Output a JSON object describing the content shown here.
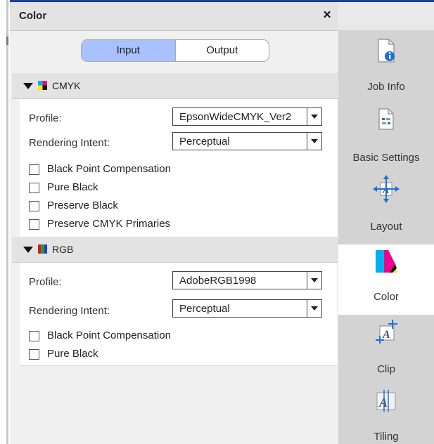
{
  "panel": {
    "title": "Color",
    "close_symbol": "×"
  },
  "mode_tabs": {
    "input": "Input",
    "output": "Output",
    "selected": "Input"
  },
  "cmyk": {
    "title": "CMYK",
    "profile_label": "Profile:",
    "profile_value": "EpsonWideCMYK_Ver2",
    "intent_label": "Rendering Intent:",
    "intent_value": "Perceptual",
    "checkboxes": [
      {
        "label": "Black Point Compensation",
        "checked": false
      },
      {
        "label": "Pure Black",
        "checked": false
      },
      {
        "label": "Preserve Black",
        "checked": false
      },
      {
        "label": "Preserve CMYK Primaries",
        "checked": false
      }
    ]
  },
  "rgb": {
    "title": "RGB",
    "profile_label": "Profile:",
    "profile_value": "AdobeRGB1998",
    "intent_label": "Rendering Intent:",
    "intent_value": "Perceptual",
    "checkboxes": [
      {
        "label": "Black Point Compensation",
        "checked": false
      },
      {
        "label": "Pure Black",
        "checked": false
      }
    ]
  },
  "side_tabs": [
    {
      "label": "Job Info",
      "icon": "job-info-icon"
    },
    {
      "label": "Basic Settings",
      "icon": "basic-settings-icon"
    },
    {
      "label": "Layout",
      "icon": "layout-icon"
    },
    {
      "label": "Color",
      "icon": "color-icon",
      "active": true
    },
    {
      "label": "Clip",
      "icon": "clip-icon"
    },
    {
      "label": "Tiling",
      "icon": "tiling-icon"
    }
  ],
  "colors": {
    "accent_line": "#1f3f9a",
    "active_segment": "#a8c1ff",
    "info_icon_blue": "#1e6fd9"
  }
}
